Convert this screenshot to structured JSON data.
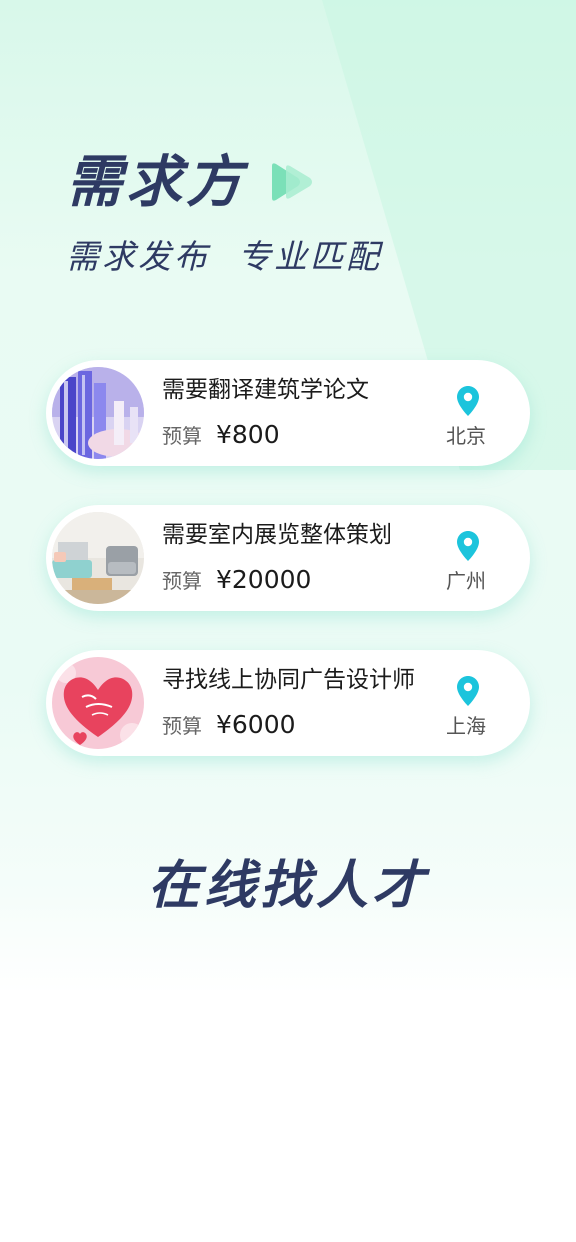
{
  "hero": {
    "title": "需求方",
    "subtitle_left": "需求发布",
    "subtitle_right": "专业匹配"
  },
  "cards": [
    {
      "title": "需要翻译建筑学论文",
      "budget_label": "预算",
      "budget_value": "¥800",
      "city": "北京",
      "image": "architecture-photo"
    },
    {
      "title": "需要室内展览整体策划",
      "budget_label": "预算",
      "budget_value": "¥20000",
      "city": "广州",
      "image": "living-room-photo"
    },
    {
      "title": "寻找线上协同广告设计师",
      "budget_label": "预算",
      "budget_value": "¥6000",
      "city": "上海",
      "image": "valentine-heart-photo"
    }
  ],
  "bottom": {
    "title": "在线找人才"
  },
  "colors": {
    "title": "#2e3a63",
    "accent_green": "#7be0b8",
    "pin": "#1cc4dc"
  },
  "icons": [
    "play-forward-icon",
    "location-pin-icon"
  ]
}
